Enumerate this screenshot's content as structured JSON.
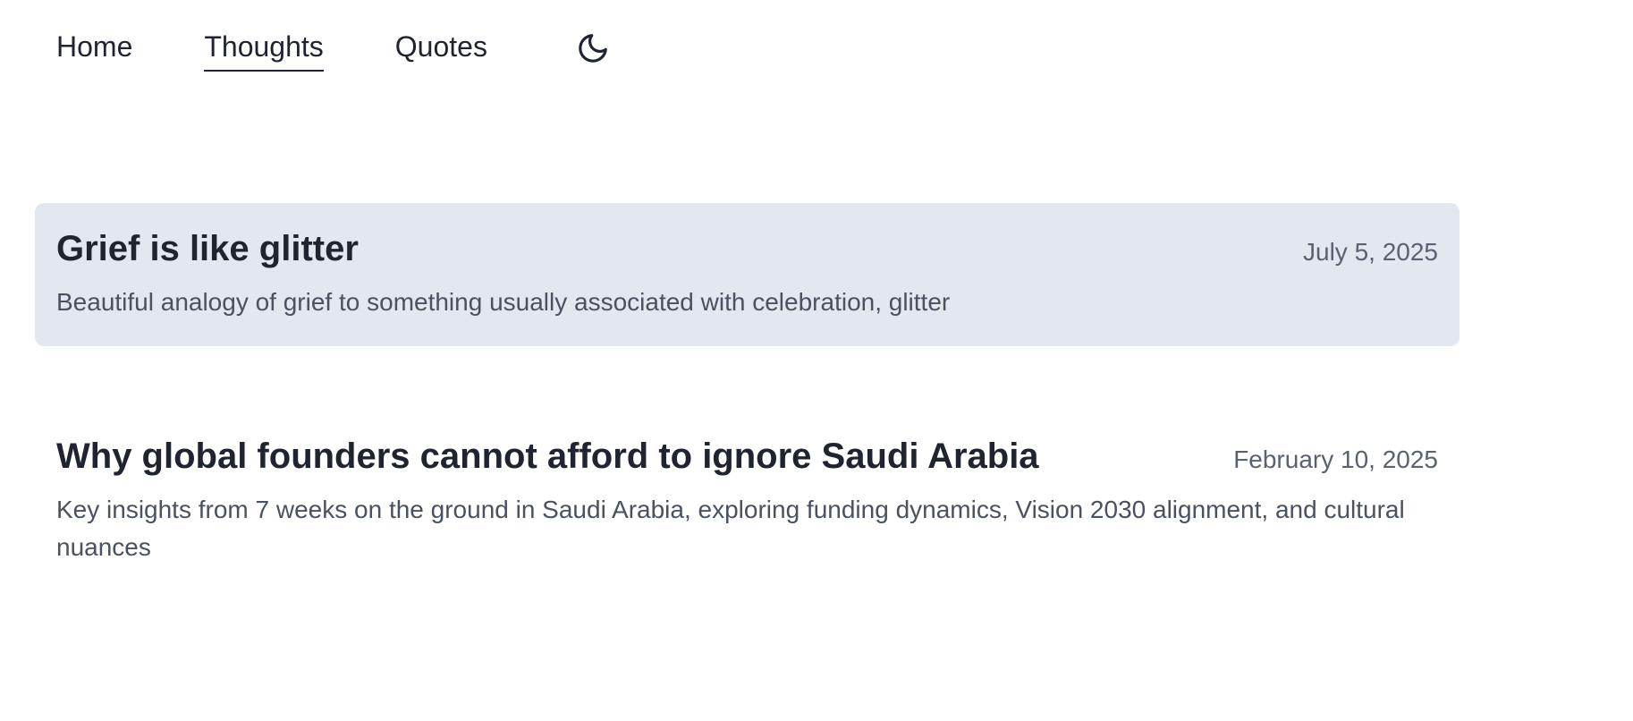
{
  "nav": {
    "home": "Home",
    "thoughts": "Thoughts",
    "quotes": "Quotes",
    "active": "thoughts",
    "theme_toggle_icon": "moon-icon"
  },
  "posts": [
    {
      "title": "Grief is like glitter",
      "date": "July 5, 2025",
      "summary": "Beautiful analogy of grief to something usually associated with celebration, glitter",
      "highlighted": true
    },
    {
      "title": "Why global founders cannot afford to ignore Saudi Arabia",
      "date": "February 10, 2025",
      "summary": "Key insights from 7 weeks on the ground in Saudi Arabia, exploring funding dynamics, Vision 2030 alignment, and cultural nuances",
      "highlighted": false
    }
  ],
  "colors": {
    "text": "#1f2430",
    "muted": "#5a6170",
    "highlight_bg": "#e3e7ef"
  }
}
